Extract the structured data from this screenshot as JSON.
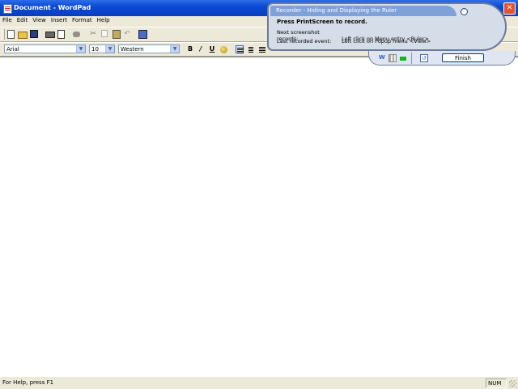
{
  "window": {
    "title": "Document - WordPad",
    "close_label": "✕"
  },
  "menu": [
    "File",
    "Edit",
    "View",
    "Insert",
    "Format",
    "Help"
  ],
  "format_bar": {
    "font_name": "Arial",
    "font_size": "10",
    "script": "Western",
    "bold": "B",
    "italic": "/",
    "underline": "U"
  },
  "status": {
    "help_text": "For Help, press F1",
    "num_lock": "NUM"
  },
  "recorder": {
    "title": "Recorder - Hiding and Displaying the Ruler",
    "instruction": "Press PrintScreen to record.",
    "next_label": "Next screenshot records:",
    "next_value": "Left click on Menu entry <Ruler>",
    "last_label": "Last recorded event:",
    "last_value": "Left click on Popup menu <View>",
    "finish_label": "Finish",
    "word_icon": "W",
    "back_icon": "↺"
  }
}
